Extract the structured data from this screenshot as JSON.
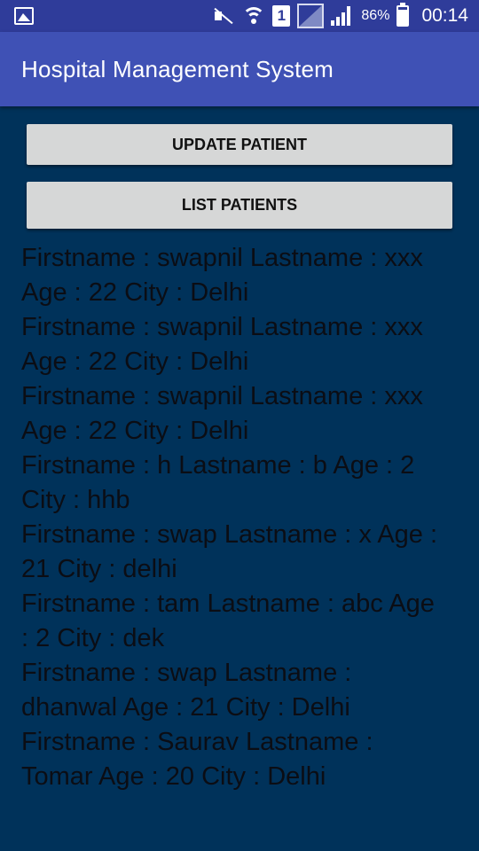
{
  "status_bar": {
    "sim_slot": "1",
    "battery_percent": "86%",
    "time": "00:14",
    "icons": [
      "gallery-icon",
      "mute-icon",
      "wifi-icon",
      "sim-icon",
      "signal-icon",
      "signal-bars-icon",
      "battery-icon"
    ]
  },
  "app_bar": {
    "title": "Hospital Management System",
    "color": "#3f51b5"
  },
  "buttons": {
    "update_label": "UPDATE PATIENT",
    "list_label": "LIST PATIENTS"
  },
  "patients": [
    "Firstname : swapnil Lastname : xxx Age : 22 City : Delhi",
    "Firstname : swapnil Lastname : xxx Age : 22 City : Delhi",
    "Firstname : swapnil Lastname : xxx Age : 22 City : Delhi",
    "Firstname : h Lastname : b Age : 2 City : hhb",
    "Firstname : swap Lastname : x Age : 21 City : delhi",
    "Firstname : tam Lastname : abc Age : 2 City : dek",
    "Firstname : swap Lastname : dhanwal Age : 21 City : Delhi",
    "Firstname : Saurav Lastname : Tomar Age : 20 City : Delhi"
  ],
  "background_color": "#00325a"
}
